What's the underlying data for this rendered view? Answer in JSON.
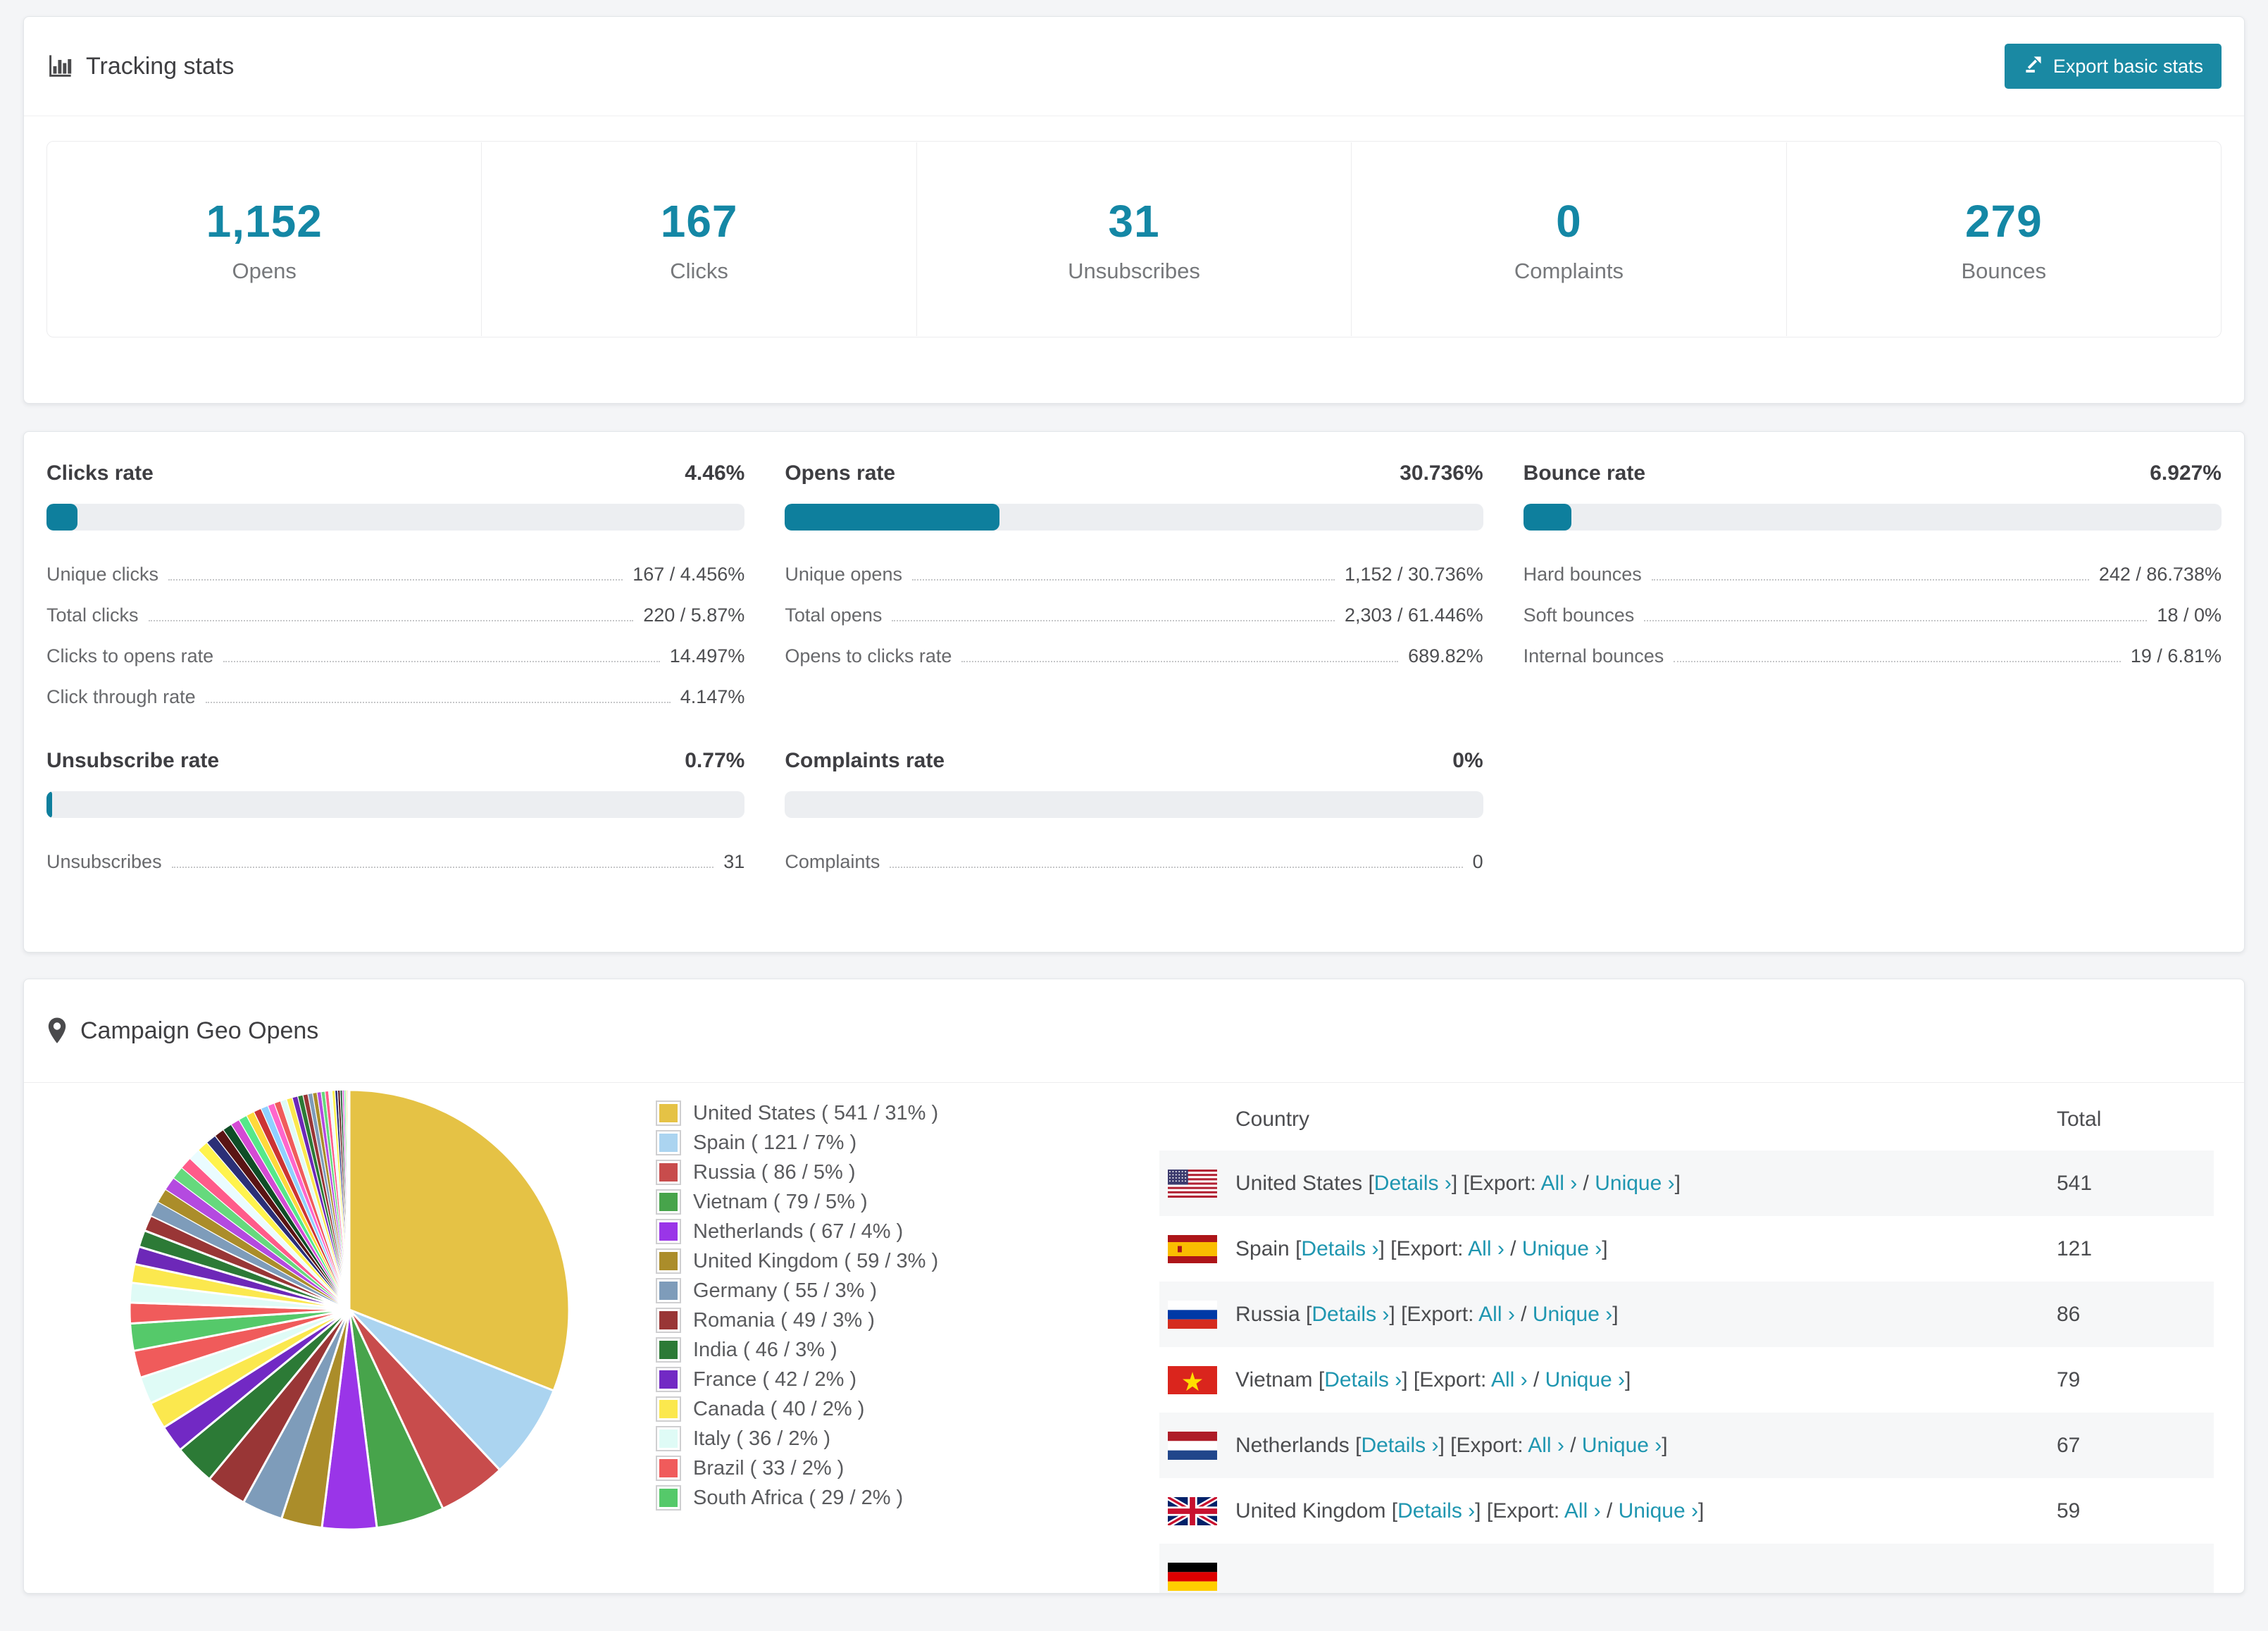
{
  "accent": "#1487a5",
  "button_color": "#1a89a3",
  "bar_fill_color": "#0e7f9d",
  "tracking": {
    "title": "Tracking stats",
    "export_button": "Export basic stats",
    "stats": [
      {
        "value": "1,152",
        "label": "Opens"
      },
      {
        "value": "167",
        "label": "Clicks"
      },
      {
        "value": "31",
        "label": "Unsubscribes"
      },
      {
        "value": "0",
        "label": "Complaints"
      },
      {
        "value": "279",
        "label": "Bounces"
      }
    ]
  },
  "rates": [
    {
      "title": "Clicks rate",
      "value": "4.46%",
      "bar_pct": 4.46,
      "rows": [
        {
          "label": "Unique clicks",
          "value": "167 / 4.456%"
        },
        {
          "label": "Total clicks",
          "value": "220 / 5.87%"
        },
        {
          "label": "Clicks to opens rate",
          "value": "14.497%"
        },
        {
          "label": "Click through rate",
          "value": "4.147%"
        }
      ]
    },
    {
      "title": "Opens rate",
      "value": "30.736%",
      "bar_pct": 30.736,
      "rows": [
        {
          "label": "Unique opens",
          "value": "1,152 / 30.736%"
        },
        {
          "label": "Total opens",
          "value": "2,303 / 61.446%"
        },
        {
          "label": "Opens to clicks rate",
          "value": "689.82%"
        }
      ]
    },
    {
      "title": "Bounce rate",
      "value": "6.927%",
      "bar_pct": 6.927,
      "rows": [
        {
          "label": "Hard bounces",
          "value": "242 / 86.738%"
        },
        {
          "label": "Soft bounces",
          "value": "18 / 0%"
        },
        {
          "label": "Internal bounces",
          "value": "19 / 6.81%"
        }
      ]
    },
    {
      "title": "Unsubscribe rate",
      "value": "0.77%",
      "bar_pct": 0.77,
      "rows": [
        {
          "label": "Unsubscribes",
          "value": "31"
        }
      ]
    },
    {
      "title": "Complaints rate",
      "value": "0%",
      "bar_pct": 0,
      "rows": [
        {
          "label": "Complaints",
          "value": "0"
        }
      ]
    }
  ],
  "geo": {
    "title": "Campaign Geo Opens",
    "table": {
      "columns": [
        "Country",
        "Total"
      ],
      "link_details": "Details ›",
      "link_export_prefix": "Export:",
      "link_all": "All ›",
      "link_unique": "Unique ›",
      "rows": [
        {
          "country": "United States",
          "flag": "us",
          "total": "541",
          "partial": false
        },
        {
          "country": "Spain",
          "flag": "es",
          "total": "121",
          "partial": false
        },
        {
          "country": "Russia",
          "flag": "ru",
          "total": "86",
          "partial": false
        },
        {
          "country": "Vietnam",
          "flag": "vn",
          "total": "79",
          "partial": false
        },
        {
          "country": "Netherlands",
          "flag": "nl",
          "total": "67",
          "partial": false
        },
        {
          "country": "United Kingdom",
          "flag": "gb",
          "total": "59",
          "partial": false
        },
        {
          "country": "",
          "flag": "de",
          "total": "",
          "partial": true
        }
      ]
    }
  },
  "chart_data": {
    "type": "pie",
    "title": "Campaign Geo Opens",
    "legend_position": "right",
    "slices": [
      {
        "label": "United States",
        "count": 541,
        "pct": 31,
        "color": "#e5c245"
      },
      {
        "label": "Spain",
        "count": 121,
        "pct": 7,
        "color": "#abd4f0"
      },
      {
        "label": "Russia",
        "count": 86,
        "pct": 5,
        "color": "#c84c4c"
      },
      {
        "label": "Vietnam",
        "count": 79,
        "pct": 5,
        "color": "#47a44b"
      },
      {
        "label": "Netherlands",
        "count": 67,
        "pct": 4,
        "color": "#9a35e8"
      },
      {
        "label": "United Kingdom",
        "count": 59,
        "pct": 3,
        "color": "#ab8d2a"
      },
      {
        "label": "Germany",
        "count": 55,
        "pct": 3,
        "color": "#7e9cba"
      },
      {
        "label": "Romania",
        "count": 49,
        "pct": 3,
        "color": "#993636"
      },
      {
        "label": "India",
        "count": 46,
        "pct": 3,
        "color": "#2c7a36"
      },
      {
        "label": "France",
        "count": 42,
        "pct": 2,
        "color": "#7229c4"
      },
      {
        "label": "Canada",
        "count": 40,
        "pct": 2,
        "color": "#fbe84e"
      },
      {
        "label": "Italy",
        "count": 36,
        "pct": 2,
        "color": "#dffbf6"
      },
      {
        "label": "Brazil",
        "count": 33,
        "pct": 2,
        "color": "#f05b5b"
      },
      {
        "label": "South Africa",
        "count": 29,
        "pct": 2,
        "color": "#55c96a"
      }
    ],
    "others_tail": {
      "weights": [
        1.45,
        1.38,
        1.31,
        1.24,
        1.18,
        1.12,
        1.06,
        1.01,
        0.96,
        0.91,
        0.86,
        0.82,
        0.78,
        0.74,
        0.7,
        0.66,
        0.63,
        0.6,
        0.57,
        0.54,
        0.51,
        0.48,
        0.46,
        0.43,
        0.41,
        0.39,
        0.37,
        0.35,
        0.33,
        0.31,
        0.29,
        0.27,
        0.25,
        0.23,
        0.21,
        0.19,
        0.17,
        0.15,
        0.13,
        0.11,
        0.09,
        0.07,
        0.05,
        0.04
      ],
      "colors": [
        "#f05b5b",
        "#dffbf6",
        "#fbe84e",
        "#6d28b8",
        "#2c7a36",
        "#993636",
        "#7e9cba",
        "#ab8d2a",
        "#b44ae0",
        "#66d97d",
        "#ff5b8a",
        "#eafcff",
        "#fff34d",
        "#2b2f77",
        "#5a1414",
        "#0f4d26",
        "#d44ad4",
        "#55e88a",
        "#ffd93b",
        "#cc3333",
        "#8fd0ff",
        "#ff66cc"
      ]
    }
  }
}
